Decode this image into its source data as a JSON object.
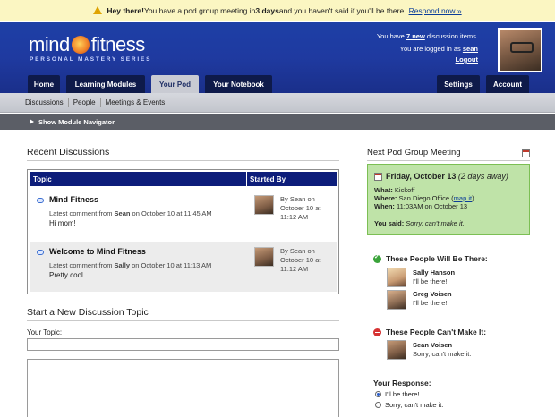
{
  "alert": {
    "greeting": "Hey there!",
    "text_pre": " You have a pod group meeting in ",
    "days": "3 days",
    "text_post": " and you haven't said if you'll be there.",
    "link": "Respond now »"
  },
  "brand": {
    "word1": "mind",
    "word2": "fitness",
    "tagline": "PERSONAL MASTERY SERIES"
  },
  "user": {
    "you_have": "You have",
    "new_count": "7 new",
    "new_suffix": "discussion items.",
    "logged_in_as": "You are logged in as",
    "username": "sean",
    "logout": "Logout"
  },
  "nav": {
    "tabs": [
      "Home",
      "Learning Modules",
      "Your Pod",
      "Your Notebook"
    ],
    "right_tabs": [
      "Settings",
      "Account"
    ],
    "active": "Your Pod"
  },
  "subnav": {
    "items": [
      "Discussions",
      "People",
      "Meetings & Events"
    ]
  },
  "module_nav": {
    "label": "Show Module Navigator"
  },
  "recent": {
    "title": "Recent Discussions",
    "col_topic": "Topic",
    "col_started": "Started By",
    "rows": [
      {
        "title": "Mind Fitness",
        "meta_pre": "Latest comment from ",
        "meta_user": "Sean",
        "meta_post": " on October 10 at 11:45 AM",
        "text": "Hi mom!",
        "by_pre": "By ",
        "by_user": "Sean",
        "by_line1_post": " on",
        "by_line2": "October 10 at",
        "by_line3": "11:12 AM"
      },
      {
        "title": "Welcome to Mind Fitness",
        "meta_pre": "Latest comment from ",
        "meta_user": "Sally",
        "meta_post": " on October 10 at 11:13 AM",
        "text": "Pretty cool.",
        "by_pre": "By ",
        "by_user": "Sean",
        "by_line1_post": " on",
        "by_line2": "October 10 at",
        "by_line3": "11:12 AM"
      }
    ]
  },
  "new_topic": {
    "title": "Start a New Discussion Topic",
    "label": "Your Topic:"
  },
  "meeting": {
    "title": "Next Pod Group Meeting",
    "date": "Friday, October 13",
    "date_note": "(2 days away)",
    "what_label": "What:",
    "what": "Kickoff",
    "where_label": "Where:",
    "where": "San Diego Office (",
    "map_link": "map it",
    "where_end": ")",
    "when_label": "When:",
    "when": "11:03AM on October 13",
    "said_label": "You said:",
    "said": "Sorry, can't make it."
  },
  "attending": {
    "title": "These People Will Be There:",
    "people": [
      {
        "name": "Sally Hanson",
        "note": "I'll be there!"
      },
      {
        "name": "Greg Voisen",
        "note": "I'll be there!"
      }
    ]
  },
  "not_attending": {
    "title": "These People Can't Make It:",
    "people": [
      {
        "name": "Sean Voisen",
        "note": "Sorry, can't make it."
      }
    ]
  },
  "response": {
    "title": "Your Response:",
    "options": [
      "I'll be there!",
      "Sorry, can't make it."
    ],
    "selected": "I'll be there!"
  },
  "colors": {
    "header_blue": "#1d3fa6",
    "table_header": "#0d1d7a",
    "meeting_green": "#bfe3a8",
    "alert_yellow": "#fbf6c2"
  }
}
